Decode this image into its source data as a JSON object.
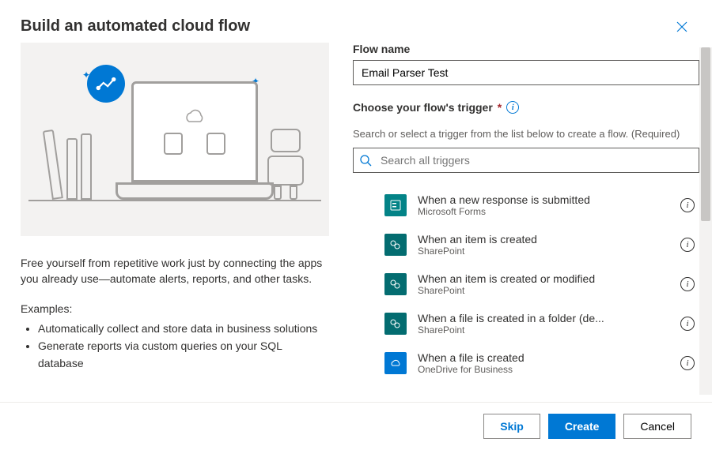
{
  "title": "Build an automated cloud flow",
  "description": "Free yourself from repetitive work just by connecting the apps you already use—automate alerts, reports, and other tasks.",
  "examples_label": "Examples:",
  "examples": [
    "Automatically collect and store data in business solutions",
    "Generate reports via custom queries on your SQL database"
  ],
  "flow_name_label": "Flow name",
  "flow_name_value": "Email Parser Test",
  "trigger_label": "Choose your flow's trigger",
  "helper_text": "Search or select a trigger from the list below to create a flow. (Required)",
  "search_placeholder": "Search all triggers",
  "triggers": [
    {
      "name": "When a new response is submitted",
      "source": "Microsoft Forms",
      "color": "#038387"
    },
    {
      "name": "When an item is created",
      "source": "SharePoint",
      "color": "#036c70"
    },
    {
      "name": "When an item is created or modified",
      "source": "SharePoint",
      "color": "#036c70"
    },
    {
      "name": "When a file is created in a folder (de...",
      "source": "SharePoint",
      "color": "#036c70"
    },
    {
      "name": "When a file is created",
      "source": "OneDrive for Business",
      "color": "#0078d4"
    }
  ],
  "buttons": {
    "skip": "Skip",
    "create": "Create",
    "cancel": "Cancel"
  }
}
